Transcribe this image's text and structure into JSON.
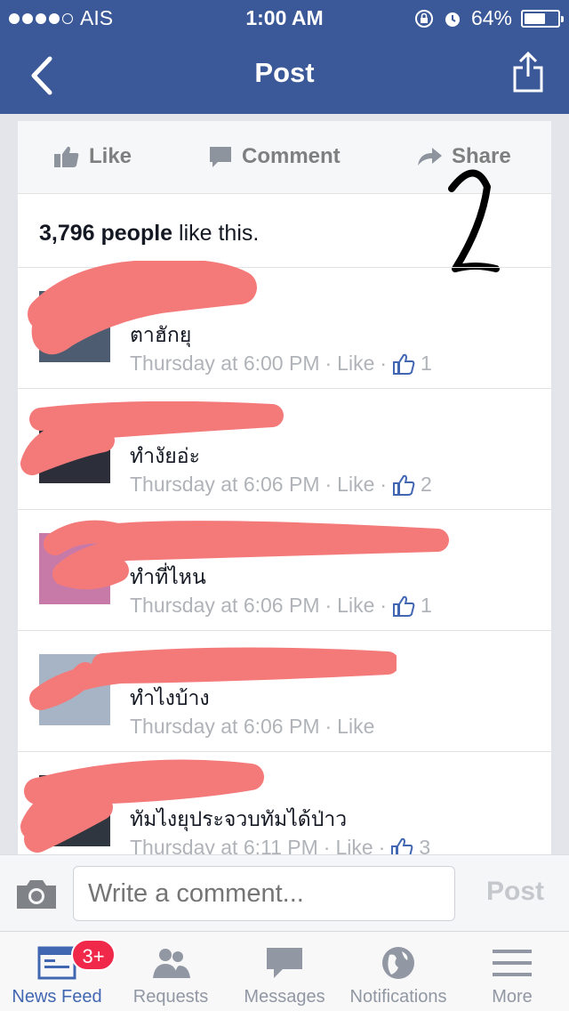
{
  "status": {
    "carrier": "AIS",
    "time": "1:00 AM",
    "battery_text": "64%",
    "battery_level": 0.64
  },
  "nav": {
    "title": "Post"
  },
  "actions": {
    "like": "Like",
    "comment": "Comment",
    "share": "Share"
  },
  "summary": {
    "count_people": "3,796 people",
    "suffix": " like this."
  },
  "annotation": "2",
  "comments": [
    {
      "text": "ตาฮักยุ",
      "time": "Thursday at 6:00 PM",
      "like": "Like",
      "likes": "1"
    },
    {
      "text": "ทำงัยอ่ะ",
      "time": "Thursday at 6:06 PM",
      "like": "Like",
      "likes": "2"
    },
    {
      "text": "ทำที่ไหน",
      "time": "Thursday at 6:06 PM",
      "like": "Like",
      "likes": "1"
    },
    {
      "text": "ทำไงบ้าง",
      "time": "Thursday at 6:06 PM",
      "like": "Like",
      "likes": ""
    },
    {
      "text": "ทัมไงยุประจวบทัมได้ป่าว",
      "time": "Thursday at 6:11 PM",
      "like": "Like",
      "likes": "3"
    }
  ],
  "composer": {
    "placeholder": "Write a comment...",
    "post": "Post"
  },
  "tabs": [
    {
      "label": "News Feed",
      "badge": "3+"
    },
    {
      "label": "Requests"
    },
    {
      "label": "Messages"
    },
    {
      "label": "Notifications"
    },
    {
      "label": "More"
    }
  ],
  "colors": {
    "brand": "#3b5998",
    "redaction": "#f47a7a"
  }
}
